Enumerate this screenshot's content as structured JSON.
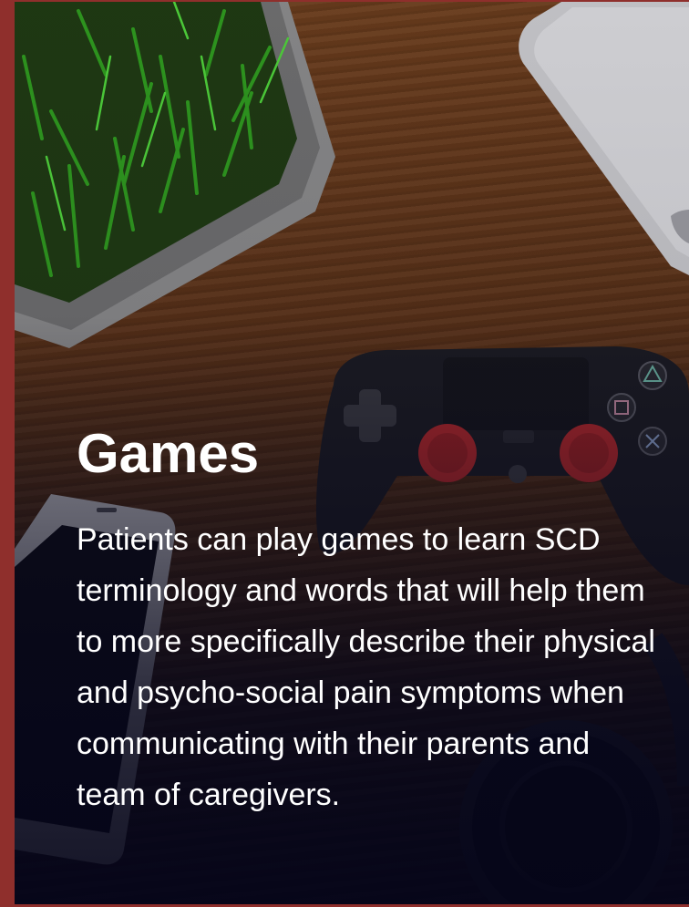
{
  "card": {
    "title": "Games",
    "description": "Patients can play games to learn SCD terminology and words that will help them to more specifically describe their physical and psycho-social pain symptoms when communicating with their parents and team of caregivers."
  },
  "colors": {
    "frame_background": "#8f2f2c",
    "text": "#ffffff",
    "controller_accent": "#b3282a"
  },
  "background_image": {
    "icons": [
      "plant-icon",
      "laptop-icon",
      "game-controller-icon",
      "smartphone-icon",
      "headphones-icon"
    ]
  }
}
